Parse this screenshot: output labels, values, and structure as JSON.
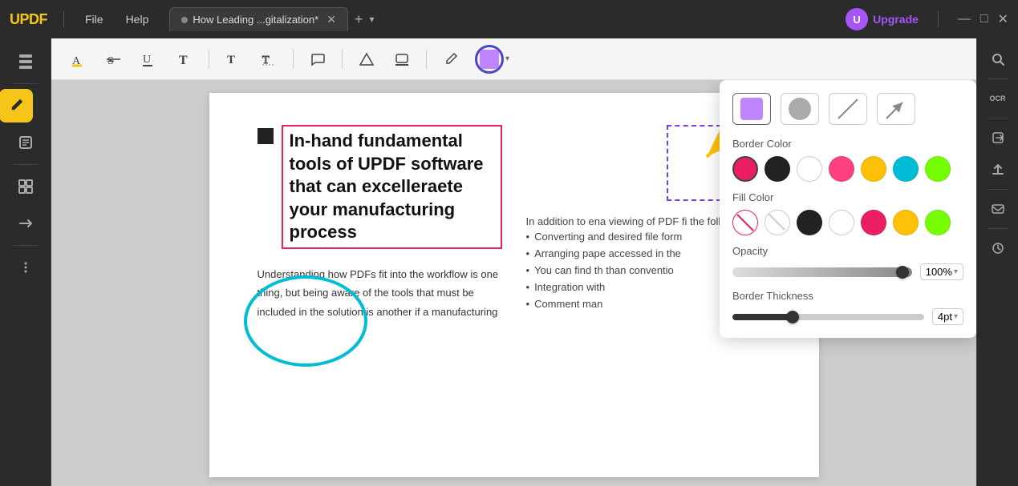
{
  "titlebar": {
    "logo": "UPDF",
    "menu_items": [
      "File",
      "Help"
    ],
    "tab_title": "How Leading ...gitalization*",
    "tab_add": "+",
    "upgrade_label": "Upgrade",
    "upgrade_initial": "U",
    "window_controls": [
      "—",
      "□",
      "✕"
    ]
  },
  "toolbar": {
    "tools": [
      {
        "name": "highlight-icon",
        "symbol": "A̲",
        "label": "Highlight"
      },
      {
        "name": "strikethrough-icon",
        "symbol": "S̶",
        "label": "Strikethrough"
      },
      {
        "name": "underline-icon",
        "symbol": "U̲",
        "label": "Underline"
      },
      {
        "name": "text-icon",
        "symbol": "T",
        "label": "Text"
      },
      {
        "name": "text-box-icon",
        "symbol": "T",
        "label": "Text Box"
      },
      {
        "name": "text-outline-icon",
        "symbol": "T̈",
        "label": "Text Outline"
      },
      {
        "name": "comment-icon",
        "symbol": "💬",
        "label": "Comment"
      },
      {
        "name": "markup-icon",
        "symbol": "▲",
        "label": "Markup"
      },
      {
        "name": "stamp-icon",
        "symbol": "🖨",
        "label": "Stamp"
      },
      {
        "name": "pencil-icon",
        "symbol": "✏️",
        "label": "Pencil"
      },
      {
        "name": "color-picker-icon",
        "symbol": "⬛",
        "label": "Color"
      }
    ],
    "active_color": "#c084fc"
  },
  "pdf": {
    "heading": "In-hand fundamental tools of UPDF software that can excelleraete your manufacturing process",
    "body_text_1": "Understanding how PDFs fit into the workflow is one thing, but being aware of the tools that must be included in the solution is another if a manufacturing",
    "right_intro": "In addition to ena viewing of PDF fi the following func",
    "bullets": [
      "Converting and desired file form",
      "Arranging pape accessed in the",
      "You can find th than conventio",
      "Integration with",
      "Comment man"
    ]
  },
  "color_panel": {
    "shapes": [
      {
        "name": "rectangle-shape",
        "active": true
      },
      {
        "name": "circle-shape",
        "active": false
      },
      {
        "name": "line-shape",
        "active": false
      },
      {
        "name": "arrow-shape",
        "active": false
      }
    ],
    "border_color_label": "Border Color",
    "border_colors": [
      {
        "hex": "#e91e63",
        "selected": true
      },
      {
        "hex": "#222222"
      },
      {
        "hex": "#ffffff"
      },
      {
        "hex": "#ff4081"
      },
      {
        "hex": "#ffc107"
      },
      {
        "hex": "#00bcd4"
      },
      {
        "hex": "#76ff03"
      }
    ],
    "fill_color_label": "Fill Color",
    "fill_colors": [
      {
        "hex": "transparent-x",
        "selected": true
      },
      {
        "hex": "transparent-slash"
      },
      {
        "hex": "#222222"
      },
      {
        "hex": "#ffffff"
      },
      {
        "hex": "#e91e63"
      },
      {
        "hex": "#ffc107"
      },
      {
        "hex": "#76ff03"
      }
    ],
    "opacity_label": "Opacity",
    "opacity_value": "100%",
    "border_thickness_label": "Border Thickness",
    "border_thickness_value": "4pt"
  },
  "left_sidebar_icons": [
    {
      "name": "pages-icon",
      "symbol": "☰",
      "active": false
    },
    {
      "name": "annotate-icon",
      "symbol": "✏",
      "active": true
    },
    {
      "name": "edit-icon",
      "symbol": "📝",
      "active": false
    },
    {
      "name": "organize-icon",
      "symbol": "📄",
      "active": false
    },
    {
      "name": "convert-icon",
      "symbol": "🔄",
      "active": false
    },
    {
      "name": "more-icon",
      "symbol": "⊞",
      "active": false
    }
  ],
  "right_sidebar_icons": [
    {
      "name": "search-icon",
      "symbol": "🔍"
    },
    {
      "name": "ocr-icon",
      "symbol": "OCR"
    },
    {
      "name": "extract-icon",
      "symbol": "⤴"
    },
    {
      "name": "share-icon",
      "symbol": "↑"
    },
    {
      "name": "mail-icon",
      "symbol": "✉"
    },
    {
      "name": "history-icon",
      "symbol": "🕐"
    }
  ]
}
